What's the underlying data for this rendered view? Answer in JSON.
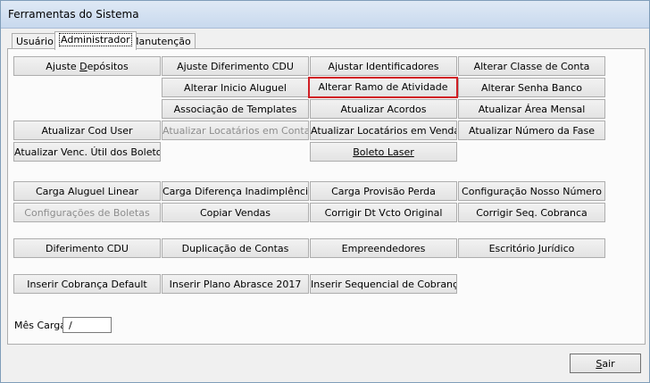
{
  "window": {
    "title": "Ferramentas do Sistema"
  },
  "tabs": [
    {
      "label": "Usuário"
    },
    {
      "label": "Administrador"
    },
    {
      "label": "Manutenção"
    }
  ],
  "buttons": {
    "ajuste_depositos_pre": "Ajuste ",
    "ajuste_depositos_acc": "D",
    "ajuste_depositos_post": "epósitos",
    "ajuste_diferimento_cdu": "Ajuste Diferimento CDU",
    "ajustar_identificadores": "Ajustar Identificadores",
    "alterar_classe_conta": "Alterar Classe de Conta",
    "alterar_inicio_aluguel": "Alterar Inicio Aluguel",
    "alterar_ramo_atividade": "Alterar Ramo de Atividade",
    "alterar_senha_banco": "Alterar Senha Banco",
    "associacao_templates": "Associação de Templates",
    "atualizar_acordos": "Atualizar Acordos",
    "atualizar_area_mensal": "Atualizar Área Mensal",
    "atualizar_cod_user": "Atualizar Cod User",
    "atualizar_locatarios_contas": "Atualizar Locatários em Contas",
    "atualizar_locatarios_vendas": "Atualizar Locatários em Vendas",
    "atualizar_numero_fase": "Atualizar Número da Fase",
    "atualizar_venc_util": "Atualizar Venc. Útil dos Boletos",
    "boleto_laser": "Boleto Laser",
    "carga_aluguel_linear": "Carga Aluguel Linear",
    "carga_diferenca_inadimplencia": "Carga Diferença Inadimplência",
    "carga_provisao_perda": "Carga Provisão Perda",
    "configuracao_nosso_numero": "Configuração Nosso Número",
    "configuracoes_boletas": "Configurações de Boletas",
    "copiar_vendas": "Copiar Vendas",
    "corrigir_dt_vcto": "Corrigir Dt Vcto Original",
    "corrigir_seq_cobranca": "Corrigir Seq. Cobranca",
    "diferimento_cdu": "Diferimento CDU",
    "duplicacao_contas": "Duplicação de Contas",
    "empreendedores": "Empreendedores",
    "escritorio_juridico": "Escritório Jurídico",
    "inserir_cobranca_default": "Inserir Cobrança Default",
    "inserir_plano_abrasce": "Inserir Plano Abrasce 2017",
    "inserir_sequencial_cobranca": "Inserir Sequencial de Cobrança"
  },
  "mes_carga": {
    "label": "Mês Carga",
    "value": " /"
  },
  "sair": {
    "acc": "S",
    "rest": "air"
  }
}
